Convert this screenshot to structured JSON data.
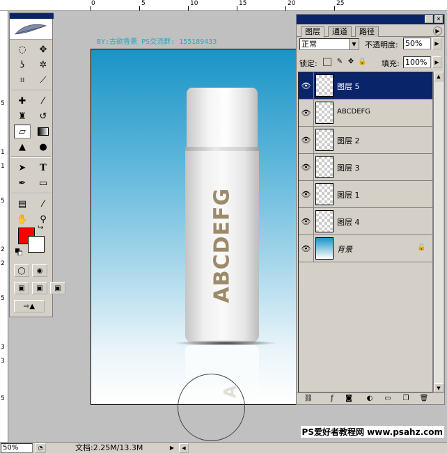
{
  "ruler": {
    "top_labels": [
      "0",
      "5",
      "10",
      "15",
      "20",
      "25"
    ],
    "left_labels": [
      "5",
      "1",
      "1",
      "5",
      "2",
      "2",
      "5",
      "3",
      "3",
      "5"
    ]
  },
  "toolbox": {
    "tools": [
      "marquee-icon",
      "move-icon",
      "lasso-icon",
      "magic-wand-icon",
      "crop-icon",
      "slice-icon",
      "healing-brush-icon",
      "brush-icon",
      "clone-stamp-icon",
      "history-brush-icon",
      "eraser-icon",
      "gradient-icon",
      "blur-icon",
      "dodge-icon",
      "path-selection-icon",
      "type-icon",
      "pen-icon",
      "shape-icon",
      "notes-icon",
      "eyedropper-icon",
      "hand-icon",
      "zoom-icon"
    ],
    "foreground_color": "#ff0000",
    "background_color": "#ffffff"
  },
  "document": {
    "caption": "BY:古欲香萧 PS交流群: 155189433",
    "bottle_text": "ABCDEFG",
    "gradient_top": "#1a94c6",
    "gradient_bottom": "#ffffff"
  },
  "layers_panel": {
    "tabs": [
      "图层",
      "通道",
      "路径"
    ],
    "blend_mode": "正常",
    "opacity_label": "不透明度:",
    "opacity_value": "50%",
    "lock_label": "锁定:",
    "fill_label": "填充:",
    "fill_value": "100%",
    "layers": [
      {
        "name": "图层 5",
        "selected": true
      },
      {
        "name": "ABCDEFG",
        "selected": false
      },
      {
        "name": "图层 2",
        "selected": false
      },
      {
        "name": "图层 3",
        "selected": false
      },
      {
        "name": "图层 1",
        "selected": false
      },
      {
        "name": "图层 4",
        "selected": false
      },
      {
        "name": "背景",
        "selected": false
      }
    ]
  },
  "status_bar": {
    "zoom": "50%",
    "doc_info": "文档:2.25M/13.3M"
  },
  "watermark": "PS爱好者教程网 www.psahz.com",
  "colors": {
    "selection": "#0a246a",
    "panel_bg": "#d4d0c8",
    "bottle_text": "#9c8a69"
  }
}
